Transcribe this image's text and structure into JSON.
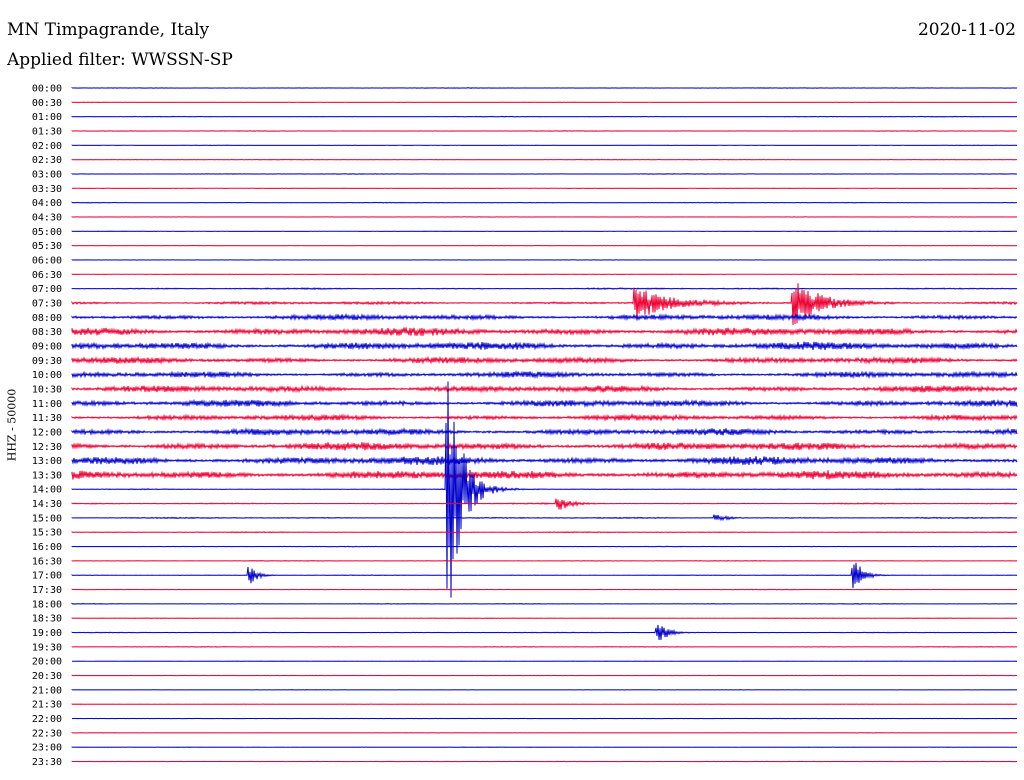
{
  "header": {
    "station": "MN Timpagrande, Italy",
    "filter": "Applied filter: WWSSN-SP",
    "date": "2020-11-02"
  },
  "chart_data": {
    "type": "line",
    "title": "MN Timpagrande, Italy",
    "subtitle": "Applied filter: WWSSN-SP",
    "date": "2020-11-02",
    "ylabel": "HHZ - 50000",
    "colors": {
      "even_rows": "#0000cc",
      "odd_rows": "#ee0033"
    },
    "grid": false,
    "rows": [
      "00:00",
      "00:30",
      "01:00",
      "01:30",
      "02:00",
      "02:30",
      "03:00",
      "03:30",
      "04:00",
      "04:30",
      "05:00",
      "05:30",
      "06:00",
      "06:30",
      "07:00",
      "07:30",
      "08:00",
      "08:30",
      "09:00",
      "09:30",
      "10:00",
      "10:30",
      "11:00",
      "11:30",
      "12:00",
      "12:30",
      "13:00",
      "13:30",
      "14:00",
      "14:30",
      "15:00",
      "15:30",
      "16:00",
      "16:30",
      "17:00",
      "17:30",
      "18:00",
      "18:30",
      "19:00",
      "19:30",
      "20:00",
      "20:30",
      "21:00",
      "21:30",
      "22:00",
      "22:30",
      "23:00",
      "23:30"
    ],
    "activity": [
      0.3,
      0.2,
      0.3,
      0.3,
      0.2,
      0.3,
      0.3,
      0.2,
      0.3,
      0.2,
      0.2,
      0.2,
      0.2,
      0.2,
      0.6,
      1.2,
      2.4,
      3.4,
      3.4,
      2.6,
      2.4,
      2.8,
      2.8,
      2.4,
      2.8,
      3.4,
      3.6,
      3.8,
      0.4,
      0.5,
      0.5,
      0.4,
      0.3,
      0.3,
      0.3,
      0.3,
      0.3,
      0.3,
      0.3,
      0.3,
      0.2,
      0.2,
      0.2,
      0.2,
      0.2,
      0.2,
      0.2,
      0.2
    ],
    "events": [
      {
        "row": "14:00",
        "minute": 12.0,
        "amplitude": 90,
        "decay": 1.6
      },
      {
        "row": "14:30",
        "minute": 15.5,
        "amplitude": 6,
        "decay": 1.2
      },
      {
        "row": "15:00",
        "minute": 20.5,
        "amplitude": 3,
        "decay": 1.2
      },
      {
        "row": "17:00",
        "minute": 5.7,
        "amplitude": 7,
        "decay": 0.8
      },
      {
        "row": "17:00",
        "minute": 24.9,
        "amplitude": 12,
        "decay": 1.0
      },
      {
        "row": "19:00",
        "minute": 18.7,
        "amplitude": 6,
        "decay": 1.2
      },
      {
        "row": "07:30",
        "minute": 18.0,
        "amplitude": 14,
        "decay": 3.0
      },
      {
        "row": "07:30",
        "minute": 23.0,
        "amplitude": 18,
        "decay": 3.0
      }
    ]
  }
}
